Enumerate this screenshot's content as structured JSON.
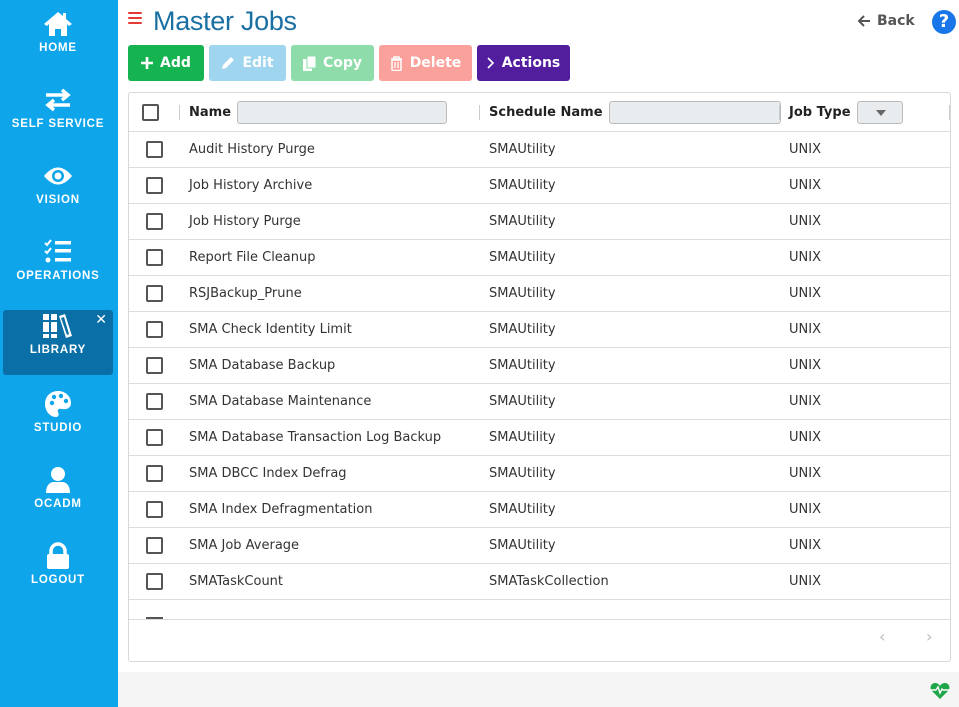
{
  "sidebar": {
    "items": [
      {
        "label": "HOME",
        "icon": "home-icon"
      },
      {
        "label": "SELF SERVICE",
        "icon": "swap-arrows-icon"
      },
      {
        "label": "VISION",
        "icon": "eye-icon"
      },
      {
        "label": "OPERATIONS",
        "icon": "checklist-icon"
      },
      {
        "label": "LIBRARY",
        "icon": "books-icon",
        "active": true,
        "close": "✕"
      },
      {
        "label": "STUDIO",
        "icon": "palette-icon"
      },
      {
        "label": "OCADM",
        "icon": "user-icon"
      },
      {
        "label": "LOGOUT",
        "icon": "lock-icon"
      }
    ]
  },
  "header": {
    "title": "Master Jobs",
    "back_label": "Back",
    "help_label": "?"
  },
  "toolbar": {
    "add_label": "Add",
    "edit_label": "Edit",
    "copy_label": "Copy",
    "delete_label": "Delete",
    "actions_label": "Actions"
  },
  "grid": {
    "columns": [
      "Name",
      "Schedule Name",
      "Job Type"
    ],
    "filters": {
      "name": "",
      "schedule_name": "",
      "job_type": ""
    },
    "rows": [
      {
        "name": "Audit History Purge",
        "schedule": "SMAUtility",
        "type": "UNIX"
      },
      {
        "name": "Job History Archive",
        "schedule": "SMAUtility",
        "type": "UNIX"
      },
      {
        "name": "Job History Purge",
        "schedule": "SMAUtility",
        "type": "UNIX"
      },
      {
        "name": "Report File Cleanup",
        "schedule": "SMAUtility",
        "type": "UNIX"
      },
      {
        "name": "RSJBackup_Prune",
        "schedule": "SMAUtility",
        "type": "UNIX"
      },
      {
        "name": "SMA Check Identity Limit",
        "schedule": "SMAUtility",
        "type": "UNIX"
      },
      {
        "name": "SMA Database Backup",
        "schedule": "SMAUtility",
        "type": "UNIX"
      },
      {
        "name": "SMA Database Maintenance",
        "schedule": "SMAUtility",
        "type": "UNIX"
      },
      {
        "name": "SMA Database Transaction Log Backup",
        "schedule": "SMAUtility",
        "type": "UNIX"
      },
      {
        "name": "SMA DBCC Index Defrag",
        "schedule": "SMAUtility",
        "type": "UNIX"
      },
      {
        "name": "SMA Index Defragmentation",
        "schedule": "SMAUtility",
        "type": "UNIX"
      },
      {
        "name": "SMA Job Average",
        "schedule": "SMAUtility",
        "type": "UNIX"
      },
      {
        "name": "SMATaskCount",
        "schedule": "SMATaskCollection",
        "type": "UNIX"
      }
    ],
    "pager": {
      "prev": "‹",
      "next": "›"
    }
  }
}
